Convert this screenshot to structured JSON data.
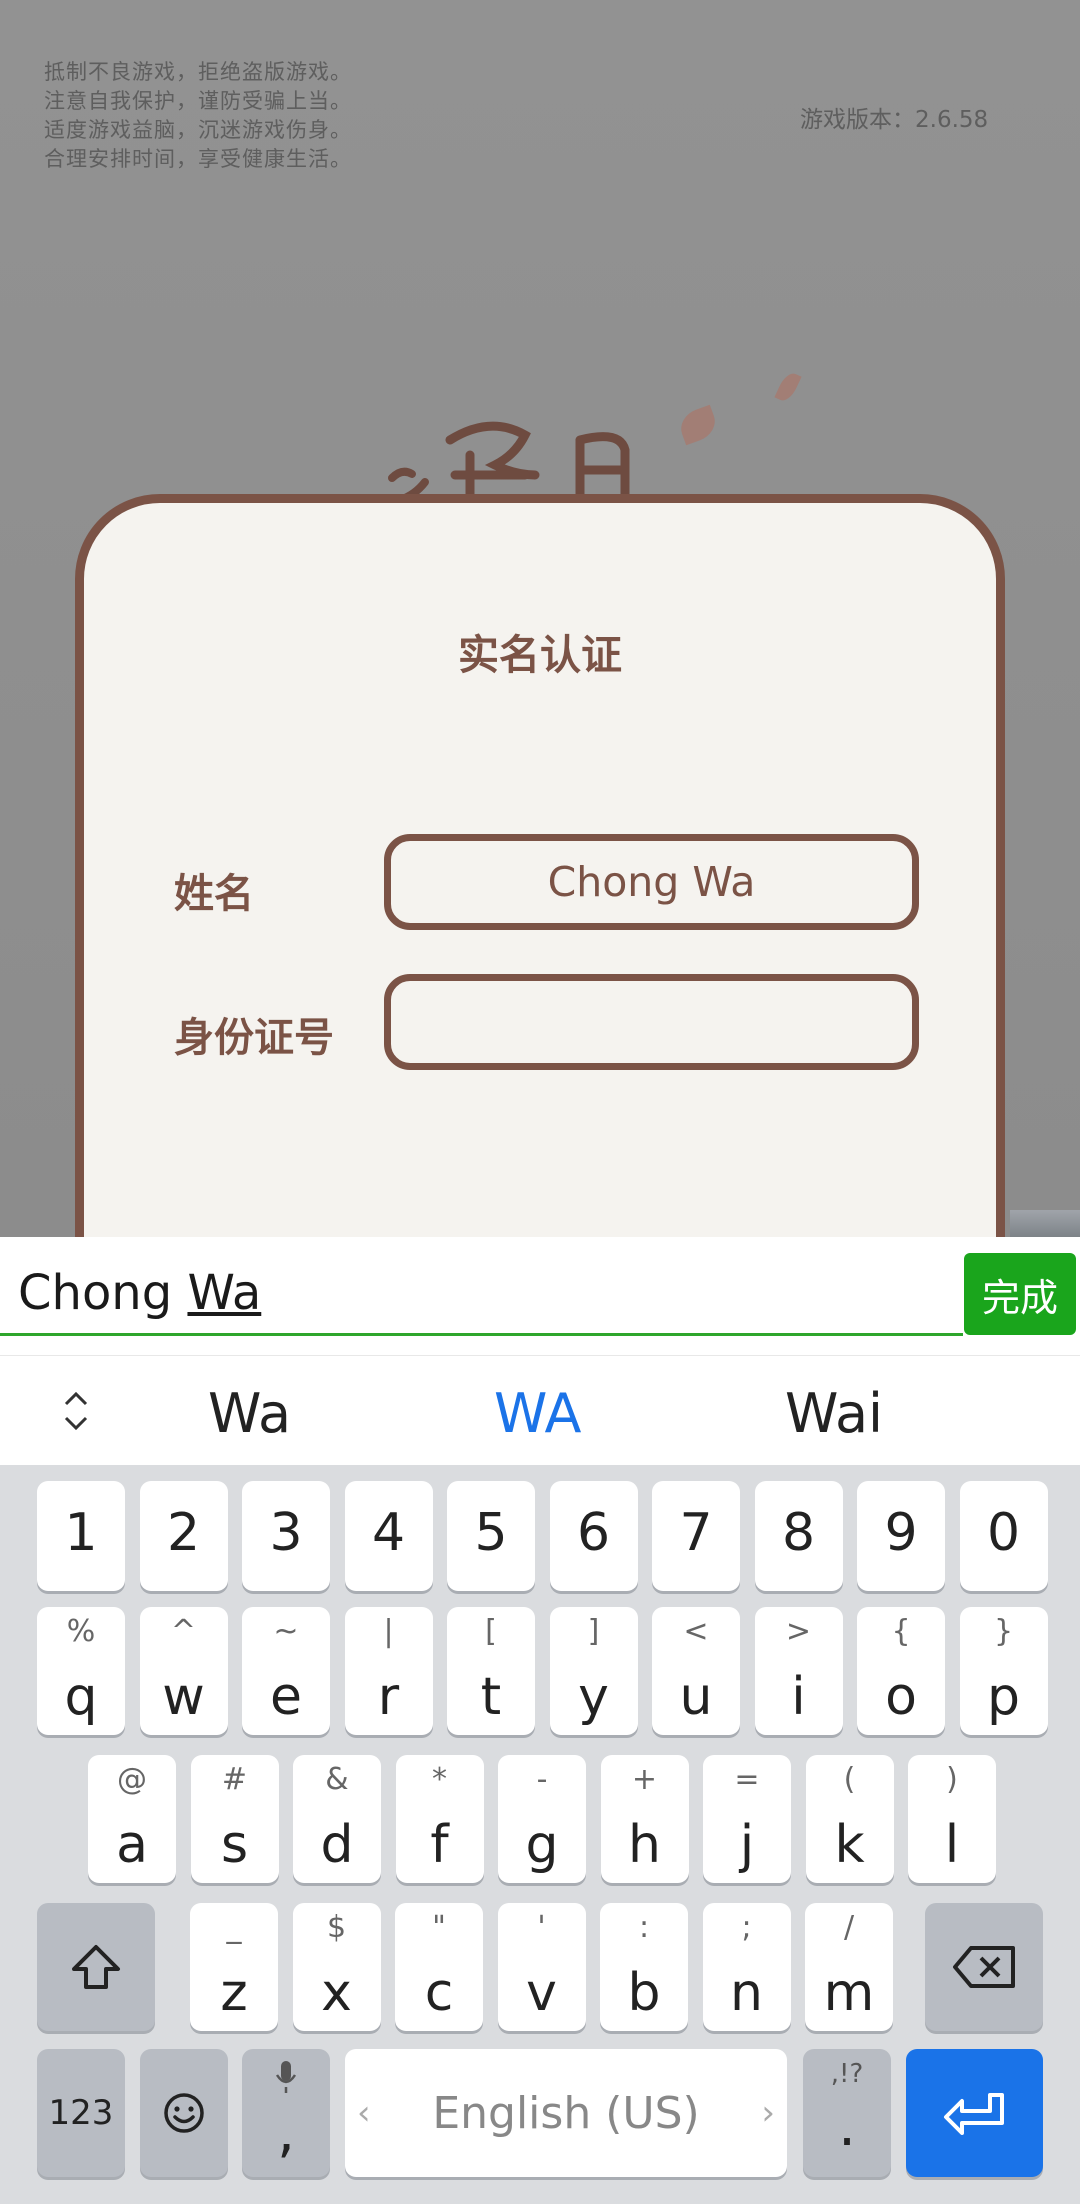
{
  "game": {
    "notice_lines": [
      "抵制不良游戏，拒绝盗版游戏。",
      "注意自我保护，谨防受骗上当。",
      "适度游戏益脑，沉迷游戏伤身。",
      "合理安排时间，享受健康生活。"
    ],
    "version": "游戏版本：2.6.58"
  },
  "dialog": {
    "title": "实名认证",
    "name_label": "姓名",
    "name_value": "Chong Wa",
    "id_label": "身份证号",
    "id_value": ""
  },
  "ime": {
    "committed": "Chong ",
    "composing": "Wa",
    "done_label": "完成",
    "suggestions": [
      "Wa",
      "WA",
      "Wai"
    ],
    "highlight_index": 1
  },
  "keyboard": {
    "numbers": [
      "1",
      "2",
      "3",
      "4",
      "5",
      "6",
      "7",
      "8",
      "9",
      "0"
    ],
    "row1": [
      {
        "k": "q",
        "s": "%"
      },
      {
        "k": "w",
        "s": "^"
      },
      {
        "k": "e",
        "s": "~"
      },
      {
        "k": "r",
        "s": "|"
      },
      {
        "k": "t",
        "s": "["
      },
      {
        "k": "y",
        "s": "]"
      },
      {
        "k": "u",
        "s": "<"
      },
      {
        "k": "i",
        "s": ">"
      },
      {
        "k": "o",
        "s": "{"
      },
      {
        "k": "p",
        "s": "}"
      }
    ],
    "row2": [
      {
        "k": "a",
        "s": "@"
      },
      {
        "k": "s",
        "s": "#"
      },
      {
        "k": "d",
        "s": "&"
      },
      {
        "k": "f",
        "s": "*"
      },
      {
        "k": "g",
        "s": "-"
      },
      {
        "k": "h",
        "s": "+"
      },
      {
        "k": "j",
        "s": "="
      },
      {
        "k": "k",
        "s": "("
      },
      {
        "k": "l",
        "s": ")"
      }
    ],
    "row3": [
      {
        "k": "z",
        "s": "_"
      },
      {
        "k": "x",
        "s": "$"
      },
      {
        "k": "c",
        "s": "\""
      },
      {
        "k": "v",
        "s": "'"
      },
      {
        "k": "b",
        "s": ":"
      },
      {
        "k": "n",
        "s": ";"
      },
      {
        "k": "m",
        "s": "/"
      }
    ],
    "mode_label": "123",
    "comma": ",",
    "space_label": "English (US)",
    "period": ".",
    "period_sub": ",!?",
    "colors": {
      "enter": "#1a73e8",
      "done": "#1aa51c",
      "highlight": "#1b73e8"
    }
  }
}
